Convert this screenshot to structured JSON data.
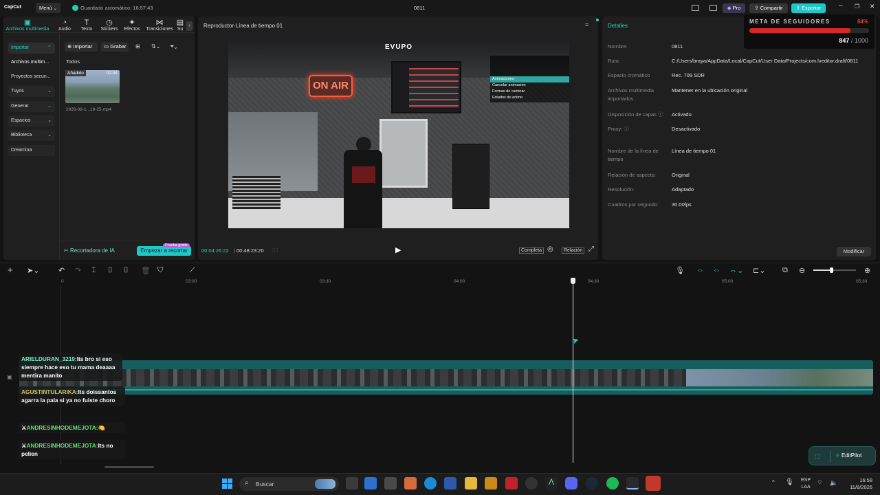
{
  "app": {
    "logo": "CapCut",
    "menu": "Menú",
    "autosave": "Guardado automático: 16:57:43",
    "project": "0811",
    "pro": "Pro",
    "share": "Compartir",
    "export": "Exportar"
  },
  "media_tabs": [
    {
      "label": "Archivos multimedia",
      "icon": "media-icon"
    },
    {
      "label": "Audio",
      "icon": "audio-icon"
    },
    {
      "label": "Texto",
      "icon": "text-icon"
    },
    {
      "label": "Stickers",
      "icon": "sticker-icon"
    },
    {
      "label": "Efectos",
      "icon": "effects-icon"
    },
    {
      "label": "Transiciones",
      "icon": "transitions-icon"
    },
    {
      "label": "Su",
      "icon": "subtitles-icon"
    }
  ],
  "left_nav": [
    {
      "label": "Importar"
    },
    {
      "label": "Archivos multim..."
    },
    {
      "label": "Proyectos secun..."
    },
    {
      "label": "Tuyos"
    },
    {
      "label": "Generar"
    },
    {
      "label": "Espacios"
    },
    {
      "label": "Biblioteca"
    },
    {
      "label": "Dreamina"
    }
  ],
  "media": {
    "import": "Importar",
    "record": "Grabar",
    "all": "Todos",
    "added_badge": "Añadido",
    "duration": "02:04",
    "filename": "2026-08-1...19-25.mp4",
    "ai_cutter": "Recortadora de IA",
    "start_cut": "Empezar a recortar",
    "trial_badge": "Prueba gratis"
  },
  "player": {
    "title": "Reproductor-Línea de tiempo 01",
    "current": "00:04:26:22",
    "total": "00:48:23:20",
    "full": "Completa",
    "ratio": "Relación",
    "overlay_logo": "EVUPO",
    "neon_sign": "ON AIR",
    "hud_menu": [
      "Animaciones",
      "Cancelar animacion",
      "Formas de caminar",
      "Estados de animo"
    ]
  },
  "details": {
    "header": "Detalles",
    "rows": [
      {
        "label": "Nombre:",
        "value": "0811"
      },
      {
        "label": "Ruta:",
        "value": "C:/Users/braya/AppData/Local/CapCut/User Data/Projects/com.lveditor.draft/0811"
      },
      {
        "label": "Espacio cromático",
        "value": "Rec. 709 SDR"
      },
      {
        "label": "Archivos multimedia importados:",
        "value": "Mantener en la ubicación original"
      },
      {
        "label": "Disposición de capas",
        "value": "Activado"
      },
      {
        "label": "Proxy:",
        "value": "Desactivado"
      },
      {
        "label": "Nombre de la línea de tiempo",
        "value": "Línea de tiempo 01"
      },
      {
        "label": "Relación de aspecto:",
        "value": "Original"
      },
      {
        "label": "Resolución:",
        "value": "Adaptado"
      },
      {
        "label": "Cuadros por segundo:",
        "value": "30.00fps"
      }
    ],
    "modify": "Modificar"
  },
  "followers": {
    "title": "META DE SEGUIDORES",
    "percent": "84%",
    "current": "847",
    "goal": "/ 1000",
    "fill": 0.847
  },
  "timeline": {
    "ticks": [
      "0",
      "03:00",
      "03:30",
      "04:00",
      "04:30",
      "05:00",
      "05:30"
    ],
    "playhead_time": "04:26"
  },
  "chat": [
    {
      "user": "ARIELDURAN_3219:",
      "text": "Its bro si eso siempre hace eso tu mama deaaaa mentira manito"
    },
    {
      "user": "AGUSTINTULARIKA:",
      "text": "Its doissantos agarra la pala si ya no fuiste choro"
    },
    {
      "user": "ANDRESINHODEMEJOTA:",
      "text": "🍋"
    },
    {
      "user": "ANDRESINHODEMEJOTA:",
      "text": "Its no pelien"
    }
  ],
  "editpilot": "EditPilot",
  "taskbar": {
    "search": "Buscar",
    "lang1": "ESP",
    "lang2": "LAA",
    "time": "16:58",
    "date": "11/8/2026"
  },
  "colors": {
    "accent": "#22d3c5",
    "bg": "#131313",
    "panel": "#1f1f1f",
    "export": "#1ec8c8"
  }
}
